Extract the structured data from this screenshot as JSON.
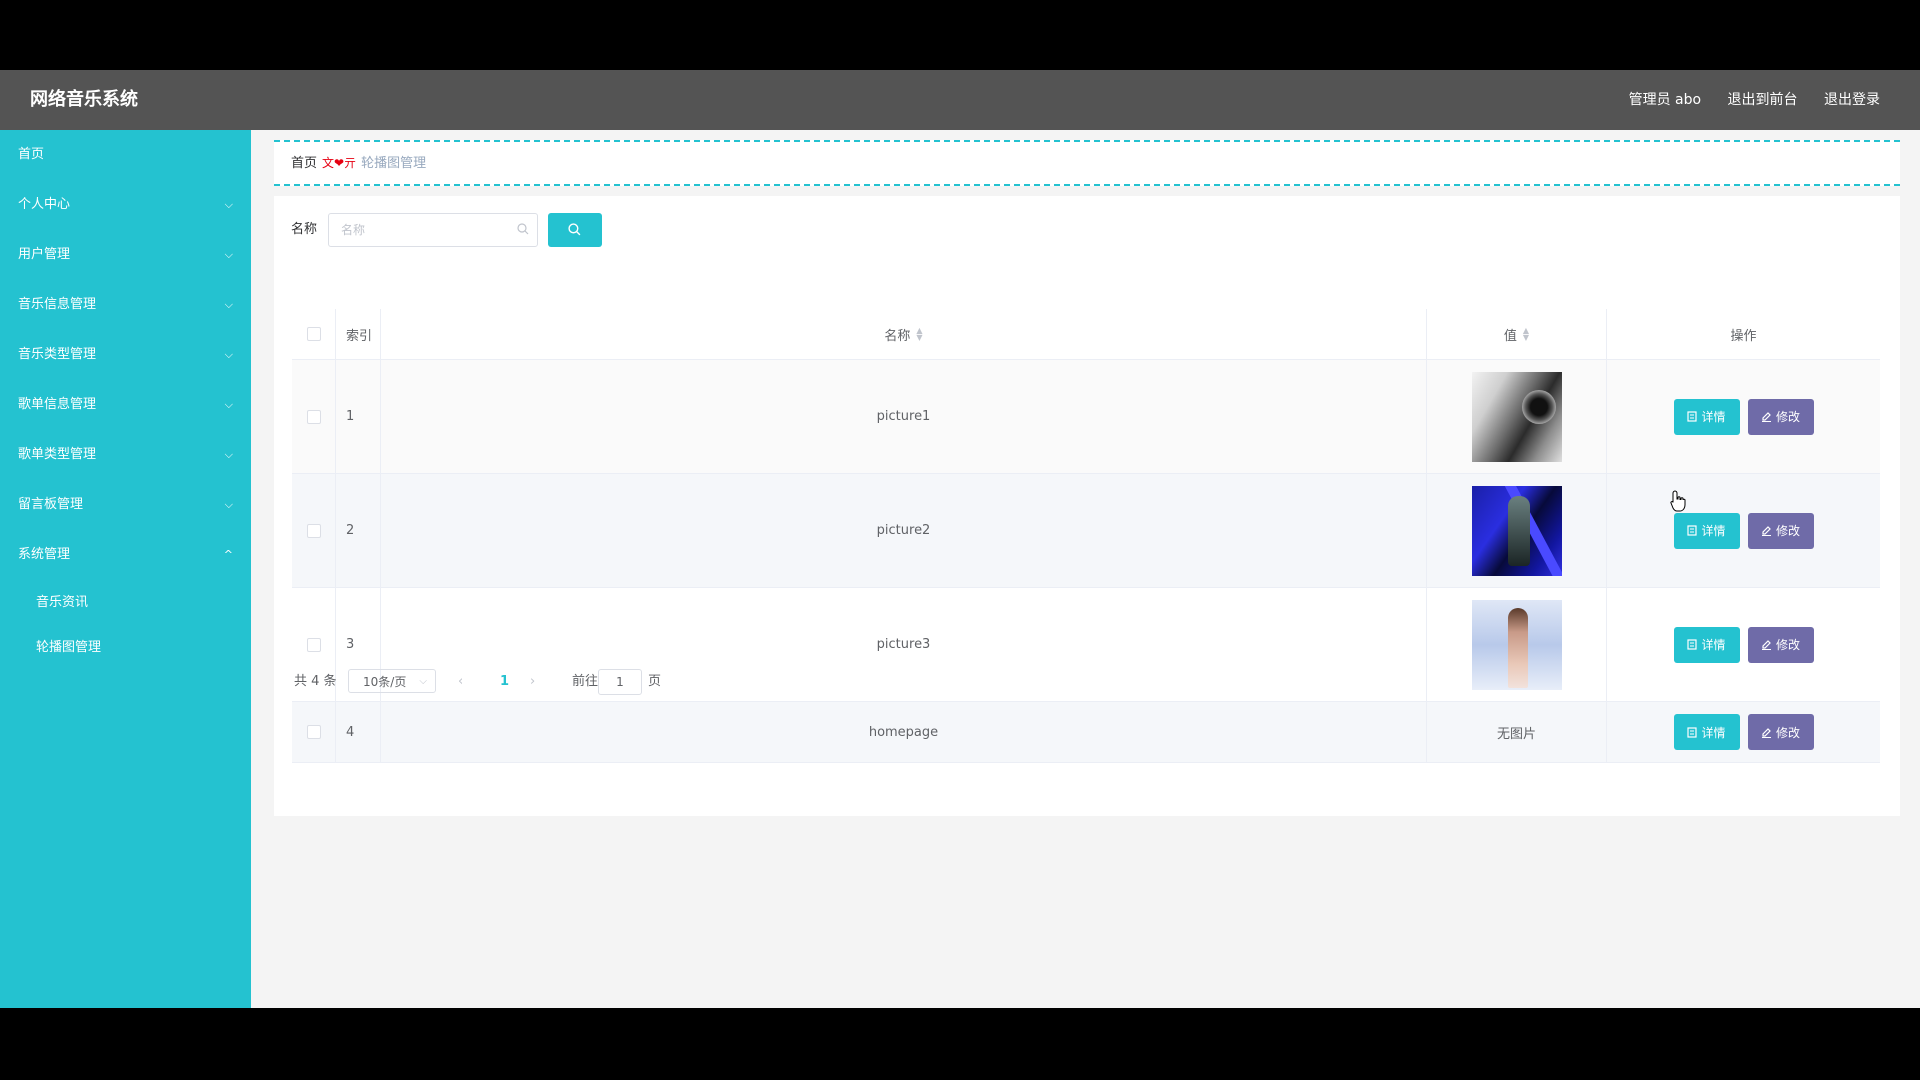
{
  "header": {
    "title": "网络音乐系统",
    "links": [
      "管理员 abo",
      "退出到前台",
      "退出登录"
    ]
  },
  "sidebar": {
    "items": [
      {
        "label": "首页",
        "chevron": ""
      },
      {
        "label": "个人中心",
        "chevron": "⌵"
      },
      {
        "label": "用户管理",
        "chevron": "⌵"
      },
      {
        "label": "音乐信息管理",
        "chevron": "⌵"
      },
      {
        "label": "音乐类型管理",
        "chevron": "⌵"
      },
      {
        "label": "歌单信息管理",
        "chevron": "⌵"
      },
      {
        "label": "歌单类型管理",
        "chevron": "⌵"
      },
      {
        "label": "留言板管理",
        "chevron": "⌵"
      },
      {
        "label": "系统管理",
        "chevron": "^"
      }
    ],
    "subitems": [
      "音乐资讯",
      "轮播图管理"
    ]
  },
  "breadcrumb": {
    "home": "首页",
    "separator": "文❤亓",
    "current": "轮播图管理"
  },
  "search": {
    "label": "名称",
    "placeholder": "名称"
  },
  "table": {
    "headers": {
      "index": "索引",
      "name": "名称",
      "value": "值",
      "actions": "操作"
    },
    "rows": [
      {
        "index": "1",
        "name": "picture1",
        "value": "",
        "image": "camera-lens-photo"
      },
      {
        "index": "2",
        "name": "picture2",
        "value": "",
        "image": "blue-stage-performer-photo"
      },
      {
        "index": "3",
        "name": "picture3",
        "value": "",
        "image": "singer-portrait-photo"
      },
      {
        "index": "4",
        "name": "homepage",
        "value": "无图片",
        "image": ""
      }
    ],
    "detail_label": "详情",
    "edit_label": "修改"
  },
  "pagination": {
    "total": "共 4 条",
    "page_size": "10条/页",
    "prev": "‹",
    "current_page": "1",
    "next": "›",
    "goto_label": "前往",
    "goto_value": "1",
    "unit": "页"
  },
  "colors": {
    "accent": "#24c2d0",
    "edit_button": "#6f6ba8",
    "topbar": "#545454",
    "breadcrumb_separator": "#e60012"
  }
}
